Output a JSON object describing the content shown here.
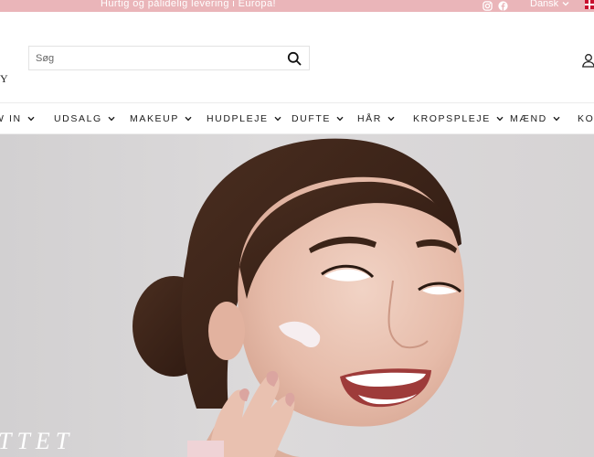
{
  "announcement": {
    "text": "Hurtig og pålidelig levering i Europa!",
    "social_icons": [
      "instagram-icon",
      "facebook-icon"
    ],
    "language": "Dansk",
    "flag": "denmark-flag"
  },
  "header": {
    "logo_fragment": "Y",
    "search": {
      "placeholder": "Søg",
      "value": ""
    },
    "account_icon": "user-icon"
  },
  "nav": {
    "items": [
      {
        "label": "W IN"
      },
      {
        "label": "UDSALG"
      },
      {
        "label": "MAKEUP"
      },
      {
        "label": "HUDPLEJE"
      },
      {
        "label": "DUFTE"
      },
      {
        "label": "HÅR"
      },
      {
        "label": "KROPSPLEJE"
      },
      {
        "label": "MÆND"
      },
      {
        "label": "KO"
      }
    ]
  },
  "hero": {
    "heading_fragment": "TTET",
    "image": "woman-applying-face-cream"
  },
  "colors": {
    "announcement_bg": "#eab5b9",
    "text": "#1c1c1c",
    "hero_bg": "#d9d7d8"
  }
}
